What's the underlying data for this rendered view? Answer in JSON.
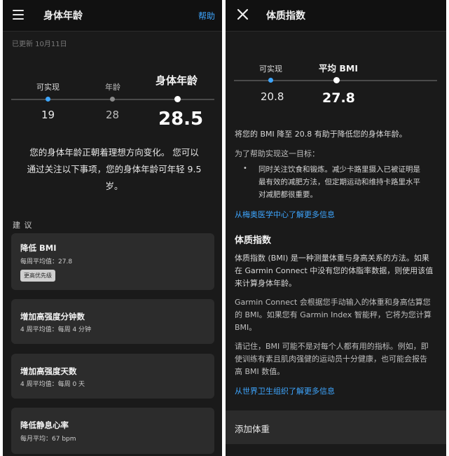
{
  "left": {
    "header": {
      "title": "身体年龄",
      "help_label": "帮助"
    },
    "updated": "已更新 10月11日",
    "scale": {
      "achievable_label": "可实现",
      "age_label": "年龄",
      "body_age_label": "身体年龄",
      "achievable_value": "19",
      "age_value": "28",
      "body_age_value": "28.5"
    },
    "description_lines": [
      "您的身体年龄正朝着理想方向变化。 您可以",
      "通过关注以下事项，您的身体年龄可年轻 9.5",
      "岁。"
    ],
    "suggestions_label": "建 议",
    "cards": [
      {
        "title": "降低 BMI",
        "sub": "每周平均值：27.8",
        "badge": "更高优先级"
      },
      {
        "title": "增加高强度分钟数",
        "sub": "4 周平均值：每周 4 分钟"
      },
      {
        "title": "增加高强度天数",
        "sub": "4 周平均值：每周 0 天"
      },
      {
        "title": "降低静息心率",
        "sub": "每月平均：67 bpm"
      }
    ]
  },
  "right": {
    "header": {
      "title": "体质指数"
    },
    "scale": {
      "achievable_label": "可实现",
      "avg_label": "平均 BMI",
      "achievable_value": "20.8",
      "avg_value": "27.8"
    },
    "intro": "将您的 BMI 降至 20.8 有助于降低您的身体年龄。",
    "goal_label": "为了帮助实现这一目标：",
    "bullet_lines": [
      "同时关注饮食和锻炼。减少卡路里摄入已被证明是",
      "最有效的减肥方法，但定期运动和维持卡路里水平",
      "对减肥都很重要。"
    ],
    "mayo_link": "从梅奥医学中心了解更多信息",
    "bmi_heading": "体质指数",
    "para1_lines": [
      "体质指数 (BMI) 是一种测量体重与身高关系的方法。如果",
      "在 Garmin Connect 中没有您的体脂率数据，则使用该值",
      "来计算身体年龄。"
    ],
    "para2_lines": [
      "Garmin Connect 会根据您手动输入的体重和身高估算您",
      "的 BMI。如果您有 Garmin Index 智能秤，它将为您计算",
      "BMI。"
    ],
    "para3_lines": [
      "请记住，BMI 可能不是对每个人都有用的指标。例如，即",
      "使训练有素且肌肉强健的运动员十分健康，也可能会报告",
      "高 BMI 数值。"
    ],
    "who_link": "从世界卫生组织了解更多信息",
    "add_weight": "添加体重"
  },
  "colors": {
    "accent_blue": "#3ea6ff",
    "panel_bg": "#1a1a1a",
    "card_bg": "#2c2c2c"
  }
}
